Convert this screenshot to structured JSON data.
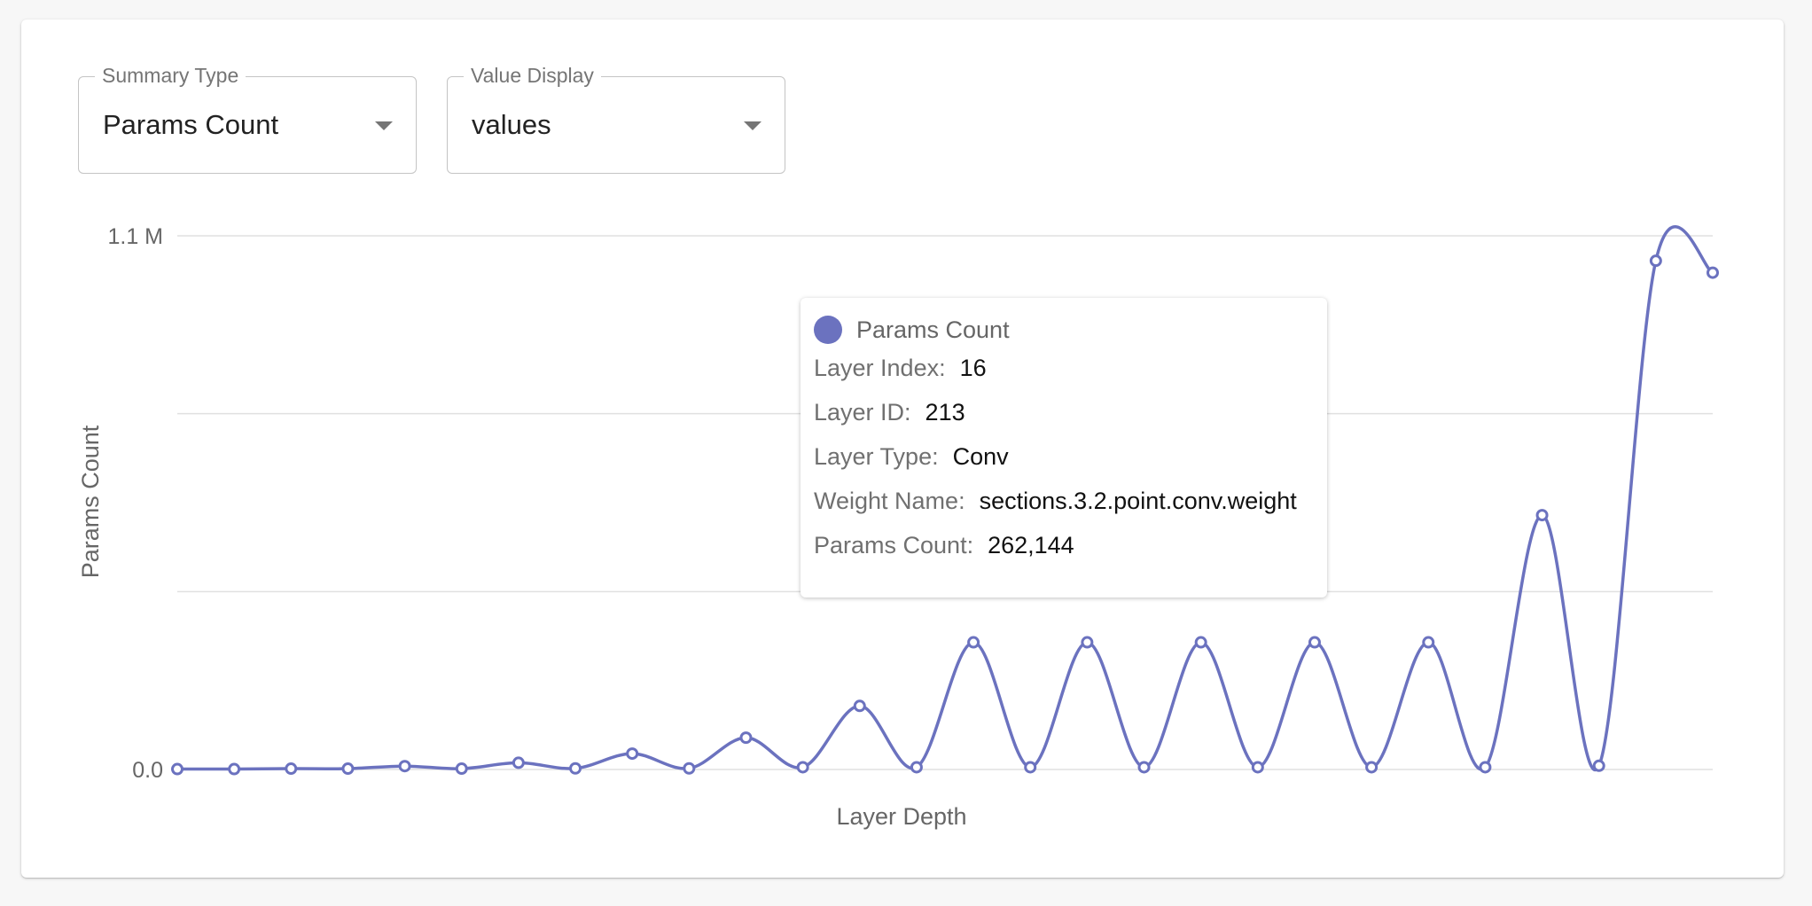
{
  "controls": {
    "summary_type": {
      "label": "Summary Type",
      "value": "Params Count"
    },
    "value_display": {
      "label": "Value Display",
      "value": "values"
    }
  },
  "colors": {
    "series": "#6b72bf",
    "grid": "#e0e0e0",
    "axis_text": "#666666"
  },
  "tooltip": {
    "series_name": "Params Count",
    "rows": [
      {
        "label": "Layer Index:",
        "value": "16"
      },
      {
        "label": "Layer ID:",
        "value": "213"
      },
      {
        "label": "Layer Type:",
        "value": "Conv"
      },
      {
        "label": "Weight Name:",
        "value": "sections.3.2.point.conv.weight"
      },
      {
        "label": "Params Count:",
        "value": "262,144"
      }
    ]
  },
  "chart_data": {
    "type": "line",
    "title": "",
    "xlabel": "Layer Depth",
    "ylabel": "Params Count",
    "ylim": [
      0,
      1100000
    ],
    "ytick_labels": [
      {
        "value": 0,
        "label": "0.0"
      },
      {
        "value": 1100000,
        "label": "1.1 M"
      }
    ],
    "grid_values": [
      0,
      366667,
      733333,
      1100000
    ],
    "x": [
      0,
      1,
      2,
      3,
      4,
      5,
      6,
      7,
      8,
      9,
      10,
      11,
      12,
      13,
      14,
      15,
      16,
      17,
      18,
      19,
      20,
      21,
      22,
      23,
      24,
      25,
      26,
      27
    ],
    "series": [
      {
        "name": "Params Count",
        "values": [
          864,
          864,
          1728,
          1728,
          6912,
          1728,
          13824,
          2304,
          32768,
          2304,
          65536,
          4608,
          131072,
          4608,
          262144,
          4608,
          262144,
          4608,
          262144,
          4608,
          262144,
          4608,
          262144,
          4608,
          524288,
          7680,
          1048576,
          1024000
        ]
      }
    ]
  }
}
